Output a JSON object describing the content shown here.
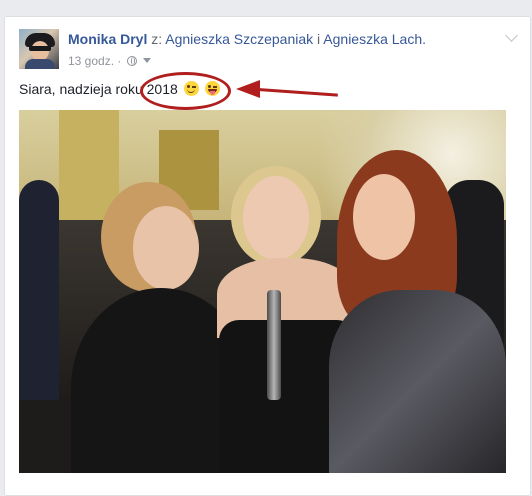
{
  "post": {
    "author": "Monika Dryl",
    "with_prefix": "z:",
    "tagged": [
      "Agnieszka Szczepaniak",
      "Agnieszka Lach."
    ],
    "conjunction": "i",
    "time": "13 godz.",
    "separator": "·",
    "text": "Siara, nadzieja roku 2018"
  },
  "icons": {
    "privacy": "globe-icon",
    "audience_dropdown": "chevron-down-icon",
    "post_menu": "chevron-down-icon",
    "emoji_1": "winking-face-emoji",
    "emoji_2": "face-with-tongue-emoji"
  },
  "colors": {
    "link": "#365899",
    "text": "#1d2129",
    "meta": "#90949c",
    "annotation": "#b01e1e",
    "background": "#e9ebee"
  }
}
